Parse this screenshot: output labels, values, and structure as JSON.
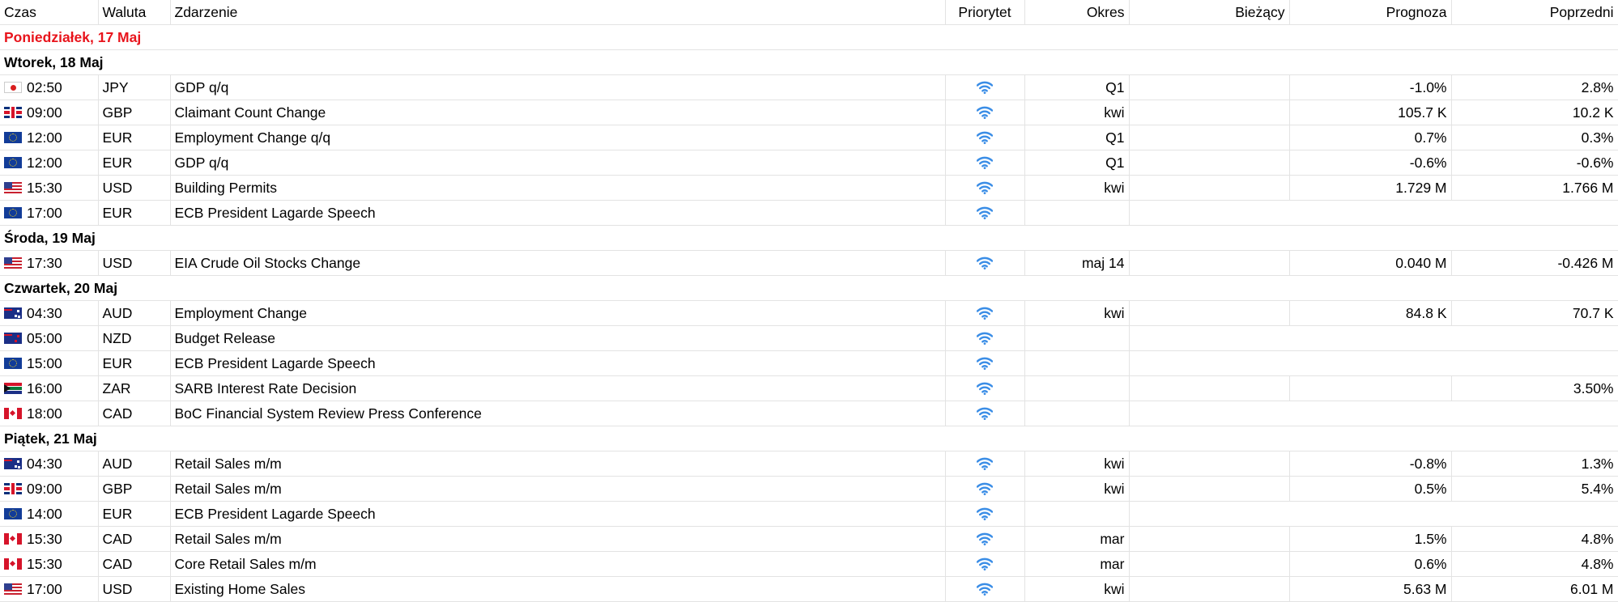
{
  "columns": {
    "time": "Czas",
    "currency": "Waluta",
    "event": "Zdarzenie",
    "priority": "Priorytet",
    "period": "Okres",
    "actual": "Bieżący",
    "forecast": "Prognoza",
    "previous": "Poprzedni"
  },
  "colors": {
    "today": "#e8141c",
    "priority_icon": "#3a8de6",
    "grid": "#e3e3e3"
  },
  "days": [
    {
      "label": "Poniedziałek, 17 Maj",
      "today": true,
      "events": []
    },
    {
      "label": "Wtorek, 18 Maj",
      "events": [
        {
          "flag": "jpy",
          "time": "02:50",
          "currency": "JPY",
          "event": "GDP q/q",
          "priority": "wifi-icon",
          "period": "Q1",
          "actual": "",
          "forecast": "-1.0%",
          "previous": "2.8%"
        },
        {
          "flag": "gbp",
          "time": "09:00",
          "currency": "GBP",
          "event": "Claimant Count Change",
          "priority": "wifi-icon",
          "period": "kwi",
          "actual": "",
          "forecast": "105.7 K",
          "previous": "10.2 K"
        },
        {
          "flag": "eur",
          "time": "12:00",
          "currency": "EUR",
          "event": "Employment Change q/q",
          "priority": "wifi-icon",
          "period": "Q1",
          "actual": "",
          "forecast": "0.7%",
          "previous": "0.3%"
        },
        {
          "flag": "eur",
          "time": "12:00",
          "currency": "EUR",
          "event": "GDP q/q",
          "priority": "wifi-icon",
          "period": "Q1",
          "actual": "",
          "forecast": "-0.6%",
          "previous": "-0.6%"
        },
        {
          "flag": "usd",
          "time": "15:30",
          "currency": "USD",
          "event": "Building Permits",
          "priority": "wifi-icon",
          "period": "kwi",
          "actual": "",
          "forecast": "1.729 M",
          "previous": "1.766 M"
        },
        {
          "flag": "eur",
          "time": "17:00",
          "currency": "EUR",
          "event": "ECB President Lagarde Speech",
          "priority": "wifi-icon",
          "period": "",
          "merged": true
        }
      ]
    },
    {
      "label": "Środa, 19 Maj",
      "events": [
        {
          "flag": "usd",
          "time": "17:30",
          "currency": "USD",
          "event": "EIA Crude Oil Stocks Change",
          "priority": "wifi-icon",
          "period": "maj 14",
          "actual": "",
          "forecast": "0.040 M",
          "previous": "-0.426 M"
        }
      ]
    },
    {
      "label": "Czwartek, 20 Maj",
      "events": [
        {
          "flag": "aud",
          "time": "04:30",
          "currency": "AUD",
          "event": "Employment Change",
          "priority": "wifi-icon",
          "period": "kwi",
          "actual": "",
          "forecast": "84.8 K",
          "previous": "70.7 K"
        },
        {
          "flag": "nzd",
          "time": "05:00",
          "currency": "NZD",
          "event": "Budget Release",
          "priority": "wifi-icon",
          "period": "",
          "merged": true
        },
        {
          "flag": "eur",
          "time": "15:00",
          "currency": "EUR",
          "event": "ECB President Lagarde Speech",
          "priority": "wifi-icon",
          "period": "",
          "merged": true
        },
        {
          "flag": "zar",
          "time": "16:00",
          "currency": "ZAR",
          "event": "SARB Interest Rate Decision",
          "priority": "wifi-icon",
          "period": "",
          "actual": "",
          "forecast": "",
          "previous": "3.50%"
        },
        {
          "flag": "cad",
          "time": "18:00",
          "currency": "CAD",
          "event": "BoC Financial System Review Press Conference",
          "priority": "wifi-icon",
          "period": "",
          "merged": true
        }
      ]
    },
    {
      "label": "Piątek, 21 Maj",
      "events": [
        {
          "flag": "aud",
          "time": "04:30",
          "currency": "AUD",
          "event": "Retail Sales m/m",
          "priority": "wifi-icon",
          "period": "kwi",
          "actual": "",
          "forecast": "-0.8%",
          "previous": "1.3%"
        },
        {
          "flag": "gbp",
          "time": "09:00",
          "currency": "GBP",
          "event": "Retail Sales m/m",
          "priority": "wifi-icon",
          "period": "kwi",
          "actual": "",
          "forecast": "0.5%",
          "previous": "5.4%"
        },
        {
          "flag": "eur",
          "time": "14:00",
          "currency": "EUR",
          "event": "ECB President Lagarde Speech",
          "priority": "wifi-icon",
          "period": "",
          "merged": true
        },
        {
          "flag": "cad",
          "time": "15:30",
          "currency": "CAD",
          "event": "Retail Sales m/m",
          "priority": "wifi-icon",
          "period": "mar",
          "actual": "",
          "forecast": "1.5%",
          "previous": "4.8%"
        },
        {
          "flag": "cad",
          "time": "15:30",
          "currency": "CAD",
          "event": "Core Retail Sales m/m",
          "priority": "wifi-icon",
          "period": "mar",
          "actual": "",
          "forecast": "0.6%",
          "previous": "4.8%"
        },
        {
          "flag": "usd",
          "time": "17:00",
          "currency": "USD",
          "event": "Existing Home Sales",
          "priority": "wifi-icon",
          "period": "kwi",
          "actual": "",
          "forecast": "5.63 M",
          "previous": "6.01 M"
        }
      ]
    }
  ]
}
